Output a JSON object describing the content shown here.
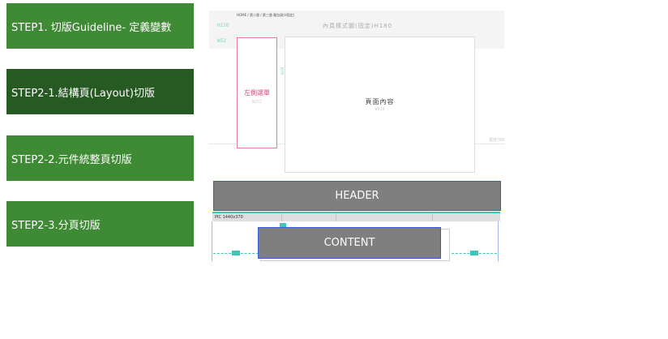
{
  "steps": [
    {
      "label": "STEP1. 切版Guideline- 定義變數"
    },
    {
      "label": "STEP2-1.結構頁(Layout)切版"
    },
    {
      "label": "STEP2-2.元件統整頁切版"
    },
    {
      "label": "STEP2-3.分頁切版"
    }
  ],
  "wireframe": {
    "breadcrumb": "HOME / 第二層 / 第三層 麵包屑(H固定)",
    "header_height_tag": "H120",
    "header_title": "內頁樣式圖(固定)H180",
    "width_tag": "W52",
    "side_menu_label": "左側選單",
    "side_menu_sub": "W252",
    "vertical_tag": "H70",
    "content_label": "頁面內容",
    "content_sub": "W910",
    "line_tag": "寬度768"
  },
  "header_bar": {
    "label": "HEADER"
  },
  "strip": {
    "label": "PIC 1440x370"
  },
  "content_bar": {
    "label": "CONTENT"
  },
  "colors": {
    "step_green": "#3f8a34",
    "step_green_active": "#275a22",
    "bar_gray": "#7f7f7f",
    "bar_border": "#3a5fcd",
    "accent_teal": "#3ec7b8",
    "menu_pink": "#e0487a"
  }
}
